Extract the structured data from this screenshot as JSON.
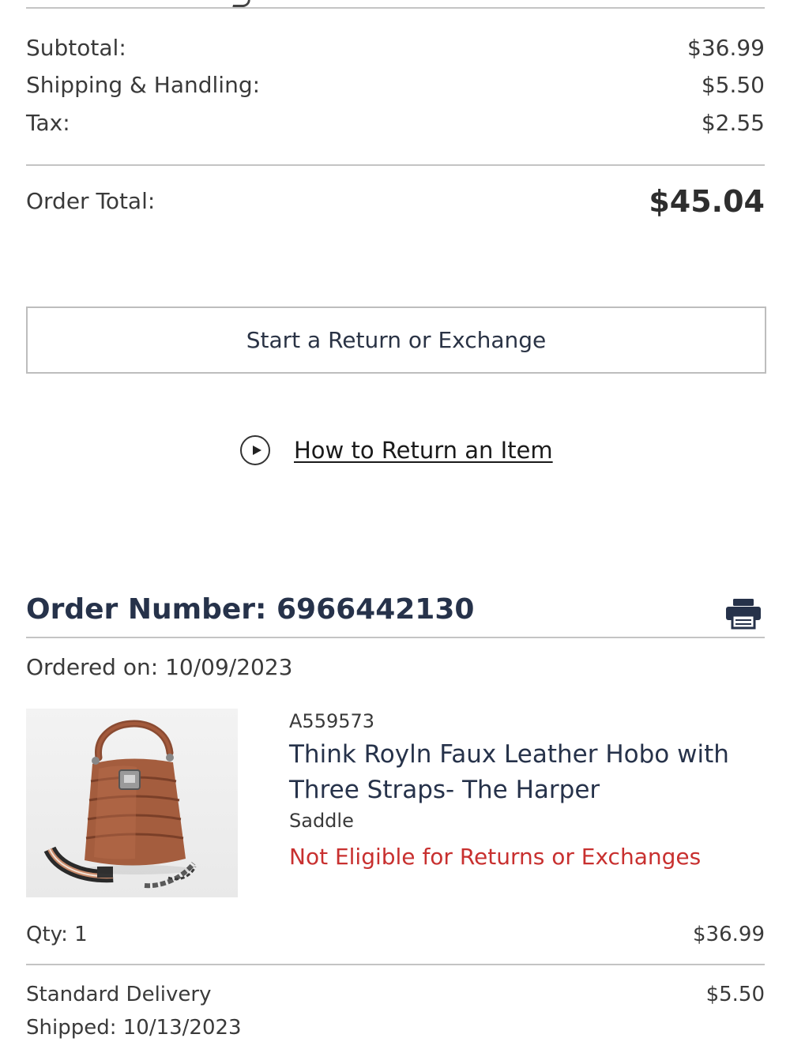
{
  "summary": {
    "subtotal_label": "Subtotal:",
    "subtotal_value": "$36.99",
    "shipping_label": "Shipping & Handling:",
    "shipping_value": "$5.50",
    "tax_label": "Tax:",
    "tax_value": "$2.55",
    "total_label": "Order Total:",
    "total_value": "$45.04"
  },
  "actions": {
    "return_button_label": "Start a Return or Exchange",
    "how_to_return_label": "How to Return an Item",
    "how_to_icon": "play-icon"
  },
  "order": {
    "number_text": "Order Number: 6966442130",
    "ordered_on": "Ordered on: 10/09/2023",
    "print_icon": "printer-icon"
  },
  "item": {
    "sku": "A559573",
    "title": "Think Royln Faux Leather Hobo with Three Straps- The Harper",
    "variant": "Saddle",
    "return_status": "Not Eligible for Returns or Exchanges",
    "qty": "Qty: 1",
    "price": "$36.99"
  },
  "delivery": {
    "method": "Standard Delivery",
    "price": "$5.50",
    "shipped": "Shipped: 10/13/2023"
  },
  "colors": {
    "navy_text": "#26324a",
    "warning_red": "#c8302f",
    "divider": "#c4c4c4"
  }
}
